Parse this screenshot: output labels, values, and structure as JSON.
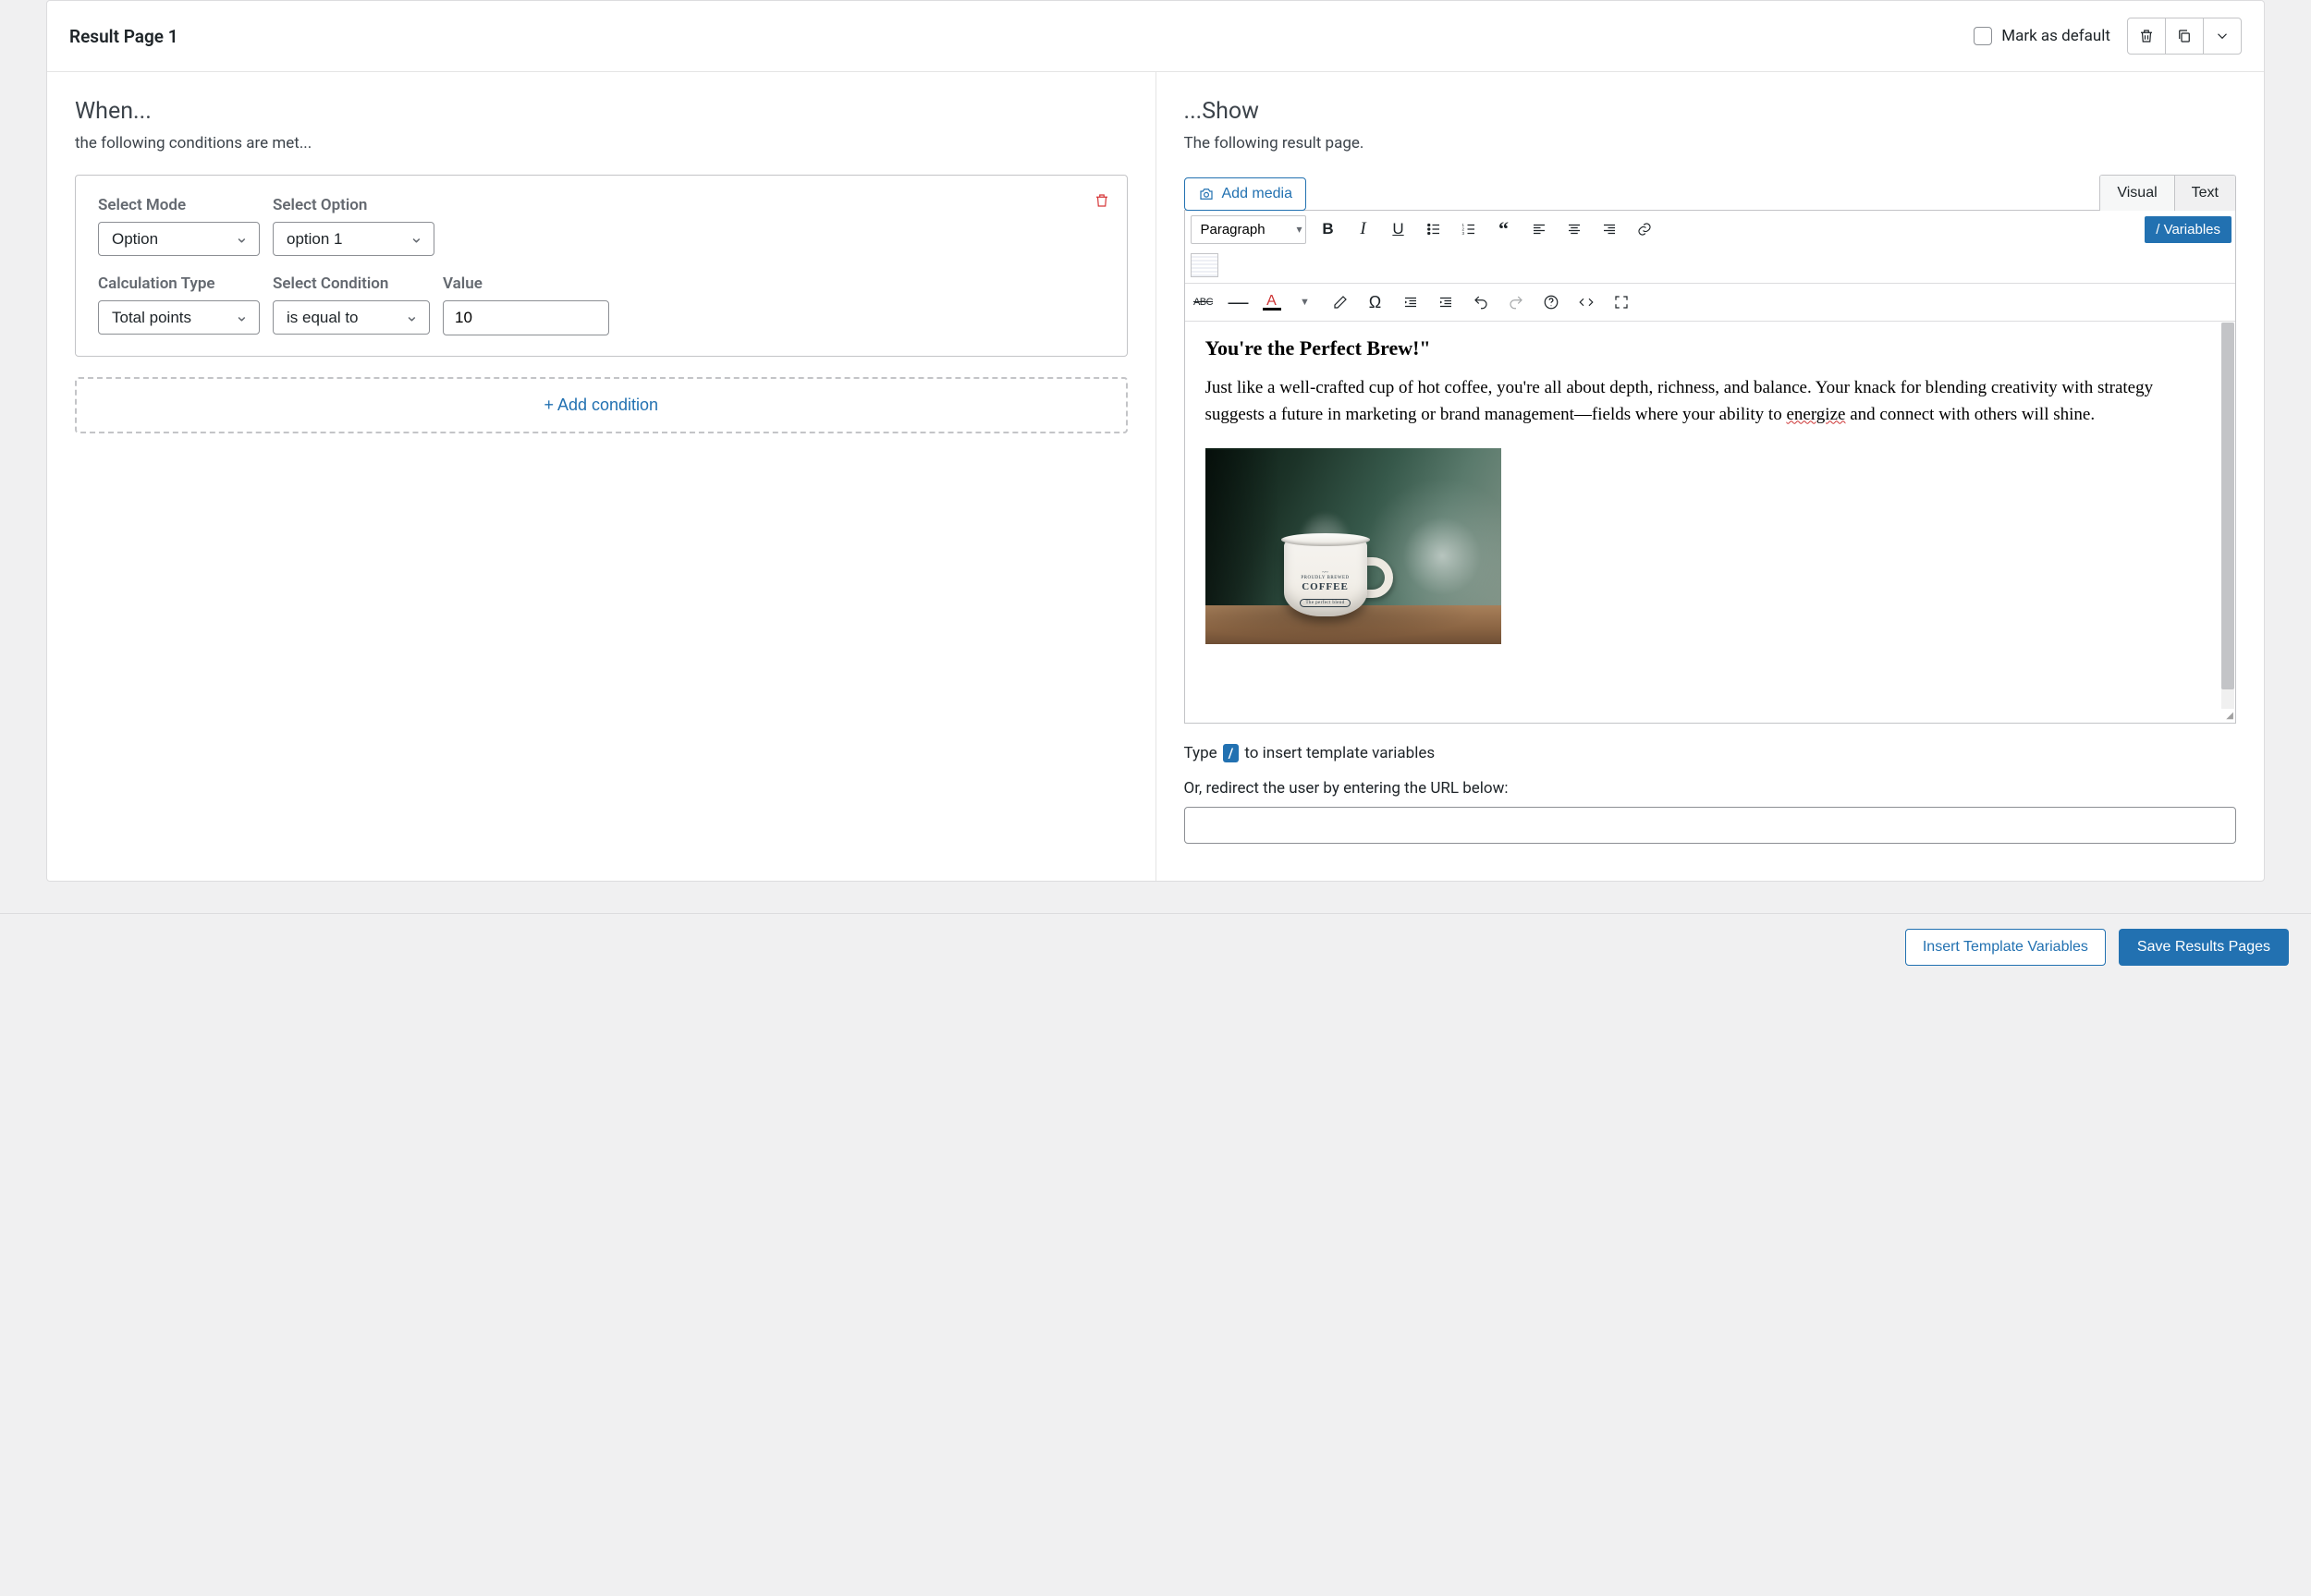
{
  "header": {
    "title": "Result Page 1",
    "mark_default_label": "Mark as default"
  },
  "when": {
    "title": "When...",
    "subtitle": "the following conditions are met...",
    "labels": {
      "select_mode": "Select Mode",
      "select_option": "Select Option",
      "calculation_type": "Calculation Type",
      "select_condition": "Select Condition",
      "value": "Value"
    },
    "condition": {
      "mode": "Option",
      "option": "option 1",
      "calc_type": "Total points",
      "condition": "is equal to",
      "value": "10"
    },
    "add_condition_label": "+ Add condition"
  },
  "show": {
    "title": "...Show",
    "subtitle": "The following result page.",
    "add_media_label": "Add media",
    "tabs": {
      "visual": "Visual",
      "text": "Text"
    },
    "format_select": "Paragraph",
    "variables_btn": "/ Variables",
    "content": {
      "heading": "You're the Perfect Brew!\"",
      "paragraph_before": "Just like a well-crafted cup of hot coffee, you're all about depth, richness, and balance. Your knack for blending creativity with strategy suggests a future in marketing or brand management—fields where your ability to ",
      "misspelled": "energize",
      "paragraph_after": " and connect with others will shine."
    },
    "image": {
      "mug_top": "PROUDLY BREWED",
      "mug_main": "COFFEE",
      "mug_bottom": "The perfect blend"
    },
    "hint_prefix": "Type ",
    "hint_slash": "/",
    "hint_suffix": " to insert template variables",
    "redirect_label": "Or, redirect the user by entering the URL below:",
    "redirect_value": ""
  },
  "footer": {
    "insert_vars": "Insert Template Variables",
    "save": "Save Results Pages"
  }
}
